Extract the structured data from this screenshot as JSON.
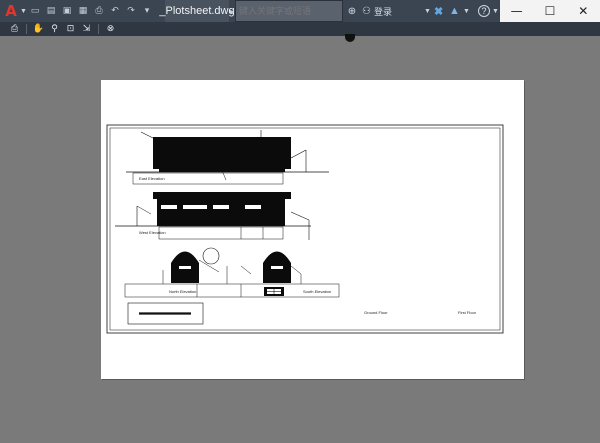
{
  "titlebar": {
    "app_logo": "A",
    "file_tab": "_Plotsheet.dwg",
    "search_placeholder": "键入关键字或短语",
    "user_label": "登录",
    "help_glyph": "?",
    "icons": {
      "app": "autocad-logo-icon",
      "search": "binoculars-icon",
      "user": "user-icon",
      "exchange": "exchange-x-icon",
      "apps": "a360-icon",
      "help": "help-icon"
    }
  },
  "window_controls": {
    "minimize": "—",
    "maximize": "☐",
    "close": "✕"
  },
  "toolbar": {
    "items": [
      "print-icon",
      "pan-icon",
      "zoom-realtime-icon",
      "zoom-window-icon",
      "zoom-extents-icon",
      "close-preview-icon"
    ]
  },
  "drawing": {
    "labels": {
      "east": "East Elevation",
      "west": "West Elevation",
      "north": "North Elevation",
      "south": "South Elevation",
      "ground": "Ground Floor",
      "first": "First Floor"
    }
  },
  "colors": {
    "background": "#7a7a7a",
    "titlebar": "#3b4451",
    "toolbar": "#2f3742",
    "accent_logo": "#e2352b",
    "paper": "#ffffff"
  }
}
